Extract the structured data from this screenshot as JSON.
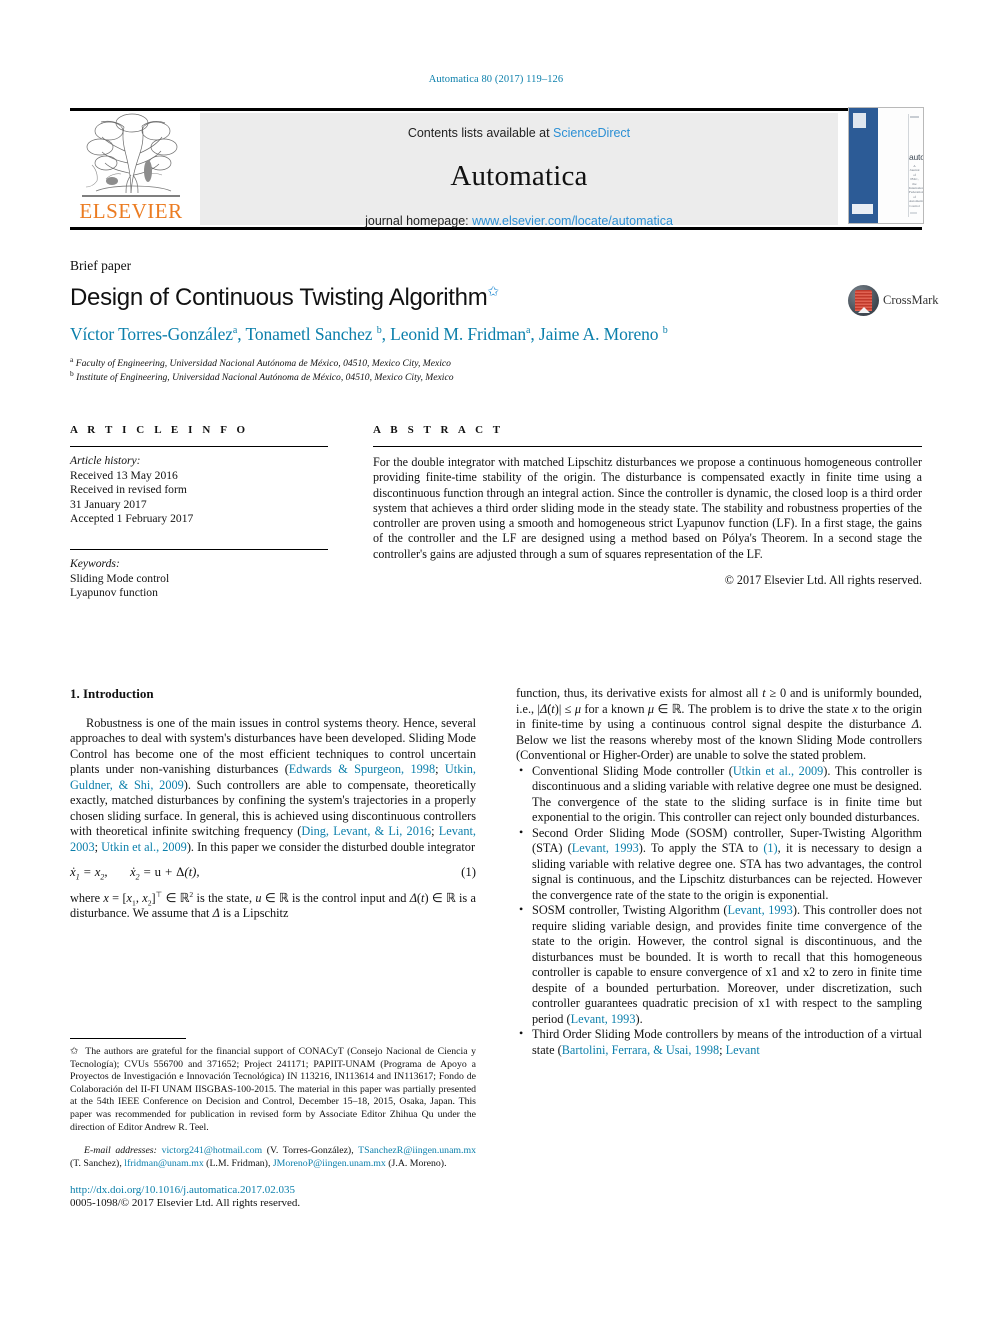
{
  "running_head": "Automatica 80 (2017) 119–126",
  "masthead": {
    "publisher": "ELSEVIER",
    "contents_prefix": "Contents lists available at ",
    "contents_link": "ScienceDirect",
    "journal_name": "Automatica",
    "homepage_prefix": "journal homepage: ",
    "homepage_link": "www.elsevier.com/locate/automatica",
    "cover": {
      "title": "automatica",
      "subtitle": "A Journal of IFAC, the International Federation of Automatic Control"
    }
  },
  "title_block": {
    "article_type": "Brief paper",
    "title": "Design of Continuous Twisting Algorithm",
    "title_footnote_marker": "✩",
    "authors_html": "Víctor Torres-González<sup>a</sup>, Tonametl Sanchez <sup>b</sup>, Leonid M. Fridman<sup>a</sup>, Jaime A. Moreno <sup>b</sup>",
    "affiliations": [
      {
        "marker": "a",
        "text": "Faculty of Engineering, Universidad Nacional Autónoma de México, 04510, Mexico City, Mexico"
      },
      {
        "marker": "b",
        "text": "Institute of Engineering, Universidad Nacional Autónoma de México, 04510, Mexico City, Mexico"
      }
    ],
    "crossmark_label": "CrossMark"
  },
  "article_info": {
    "heading": "A R T I C L E   I N F O",
    "history_label": "Article history:",
    "history_lines": [
      "Received 13 May 2016",
      "Received in revised form",
      "31 January 2017",
      "Accepted 1 February 2017"
    ],
    "keywords_label": "Keywords:",
    "keywords": [
      "Sliding Mode control",
      "Lyapunov function"
    ]
  },
  "abstract": {
    "heading": "A B S T R A C T",
    "text": "For the double integrator with matched Lipschitz disturbances we propose a continuous homogeneous controller providing finite-time stability of the origin. The disturbance is compensated exactly in finite time using a discontinuous function through an integral action. Since the controller is dynamic, the closed loop is a third order system that achieves a third order sliding mode in the steady state. The stability and robustness properties of the controller are proven using a smooth and homogeneous strict Lyapunov function (LF). In a first stage, the gains of the controller and the LF are designed using a method based on Pólya's Theorem. In a second stage the controller's gains are adjusted through a sum of squares representation of the LF.",
    "copyright": "© 2017 Elsevier Ltd. All rights reserved."
  },
  "body": {
    "section_heading": "1. Introduction",
    "left_para1_a": "Robustness is one of the main issues in control systems theory. Hence, several approaches to deal with system's disturbances have been developed. Sliding Mode Control has become one of the most efficient techniques to control uncertain plants under non-vanishing disturbances (",
    "left_cite1": "Edwards & Spurgeon, 1998",
    "left_sep1": "; ",
    "left_cite2": "Utkin, Guldner, & Shi, 2009",
    "left_para1_b": "). Such controllers are able to compensate, theoretically exactly, matched disturbances by confining the system's trajectories in a properly chosen sliding surface. In general, this is achieved using discontinuous controllers with theoretical infinite switching frequency (",
    "left_cite3": "Ding, Levant, & Li, 2016",
    "left_cite4": "Levant, 2003",
    "left_cite5": "Utkin et al., 2009",
    "left_para1_c": "). In this paper we consider the disturbed double integrator",
    "equation_1_number": "(1)",
    "left_para2": "where x = [x1, x2]⊤ ∈ ℝ² is the state, u ∈ ℝ is the control input and Δ(t) ∈ ℝ is a disturbance. We assume that Δ is a Lipschitz",
    "right_para1": "function, thus, its derivative exists for almost all t ≥ 0 and is uniformly bounded, i.e., |Δ̇(t)| ≤ μ for a known μ ∈ ℝ. The problem is to drive the state x to the origin in finite-time by using a continuous control signal despite the disturbance Δ. Below we list the reasons whereby most of the known Sliding Mode controllers (Conventional or Higher-Order) are unable to solve the stated problem.",
    "bullets": [
      {
        "pre": "Conventional Sliding Mode controller (",
        "cite": "Utkin et al., 2009",
        "post": "). This controller is discontinuous and a sliding variable with relative degree one must be designed. The convergence of the state to the sliding surface is in finite time but exponential to the origin. This controller can reject only bounded disturbances."
      },
      {
        "pre": "Second Order Sliding Mode (SOSM) controller, Super-Twisting Algorithm (STA) (",
        "cite": "Levant, 1993",
        "mid": "). To apply the STA to ",
        "cite2": "(1)",
        "post": ", it is necessary to design a sliding variable with relative degree one. STA has two advantages, the control signal is continuous, and the Lipschitz disturbances can be rejected. However the convergence rate of the state to the origin is exponential."
      },
      {
        "pre": "SOSM controller, Twisting Algorithm (",
        "cite": "Levant, 1993",
        "post": "). This controller does not require sliding variable design, and provides finite time convergence of the state to the origin. However, the control signal is discontinuous, and the disturbances must be bounded. It is worth to recall that this homogeneous controller is capable to ensure convergence of x1 and x2 to zero in finite time despite of a bounded perturbation. Moreover, under discretization, such controller guarantees quadratic precision of x1 with respect to the sampling period (",
        "cite3": "Levant, 1993",
        "tail": ")."
      },
      {
        "pre": "Third Order Sliding Mode controllers by means of the introduction of a virtual state (",
        "cite": "Bartolini, Ferrara, & Usai, 1998",
        "sep": "; ",
        "cite2": "Levant",
        "post": ""
      }
    ]
  },
  "footnote": {
    "marker": "✩",
    "text": "The authors are grateful for the financial support of CONACyT (Consejo Nacional de Ciencia y Tecnología); CVUs 556700 and 371652; Project 241171; PAPIIT-UNAM (Programa de Apoyo a Proyectos de Investigación e Innovación Tecnológica) IN 113216, IN113614 and IN113617; Fondo de Colaboración del II-FI UNAM IISGBAS-100-2015. The material in this paper was partially presented at the 54th IEEE Conference on Decision and Control, December 15–18, 2015, Osaka, Japan. This paper was recommended for publication in revised form by Associate Editor Zhihua Qu under the direction of Editor Andrew R. Teel.",
    "emails_label": "E-mail addresses:",
    "emails": [
      {
        "address": "victorg241@hotmail.com",
        "person": " (V. Torres-González),"
      },
      {
        "address": "TSanchezR@iingen.unam.mx",
        "person": " (T. Sanchez),"
      },
      {
        "address": "lfridman@unam.mx",
        "person": " (L.M. Fridman),"
      },
      {
        "address": "JMorenoP@iingen.unam.mx",
        "person": " (J.A. Moreno)."
      }
    ],
    "doi": "http://dx.doi.org/10.1016/j.automatica.2017.02.035",
    "issn_line": "0005-1098/© 2017 Elsevier Ltd. All rights reserved."
  },
  "colors": {
    "link_blue": "#0b7fab",
    "sd_blue": "#2b8fd4",
    "elsevier_orange": "#eb7c22",
    "cover_blue": "#2c5b96"
  }
}
